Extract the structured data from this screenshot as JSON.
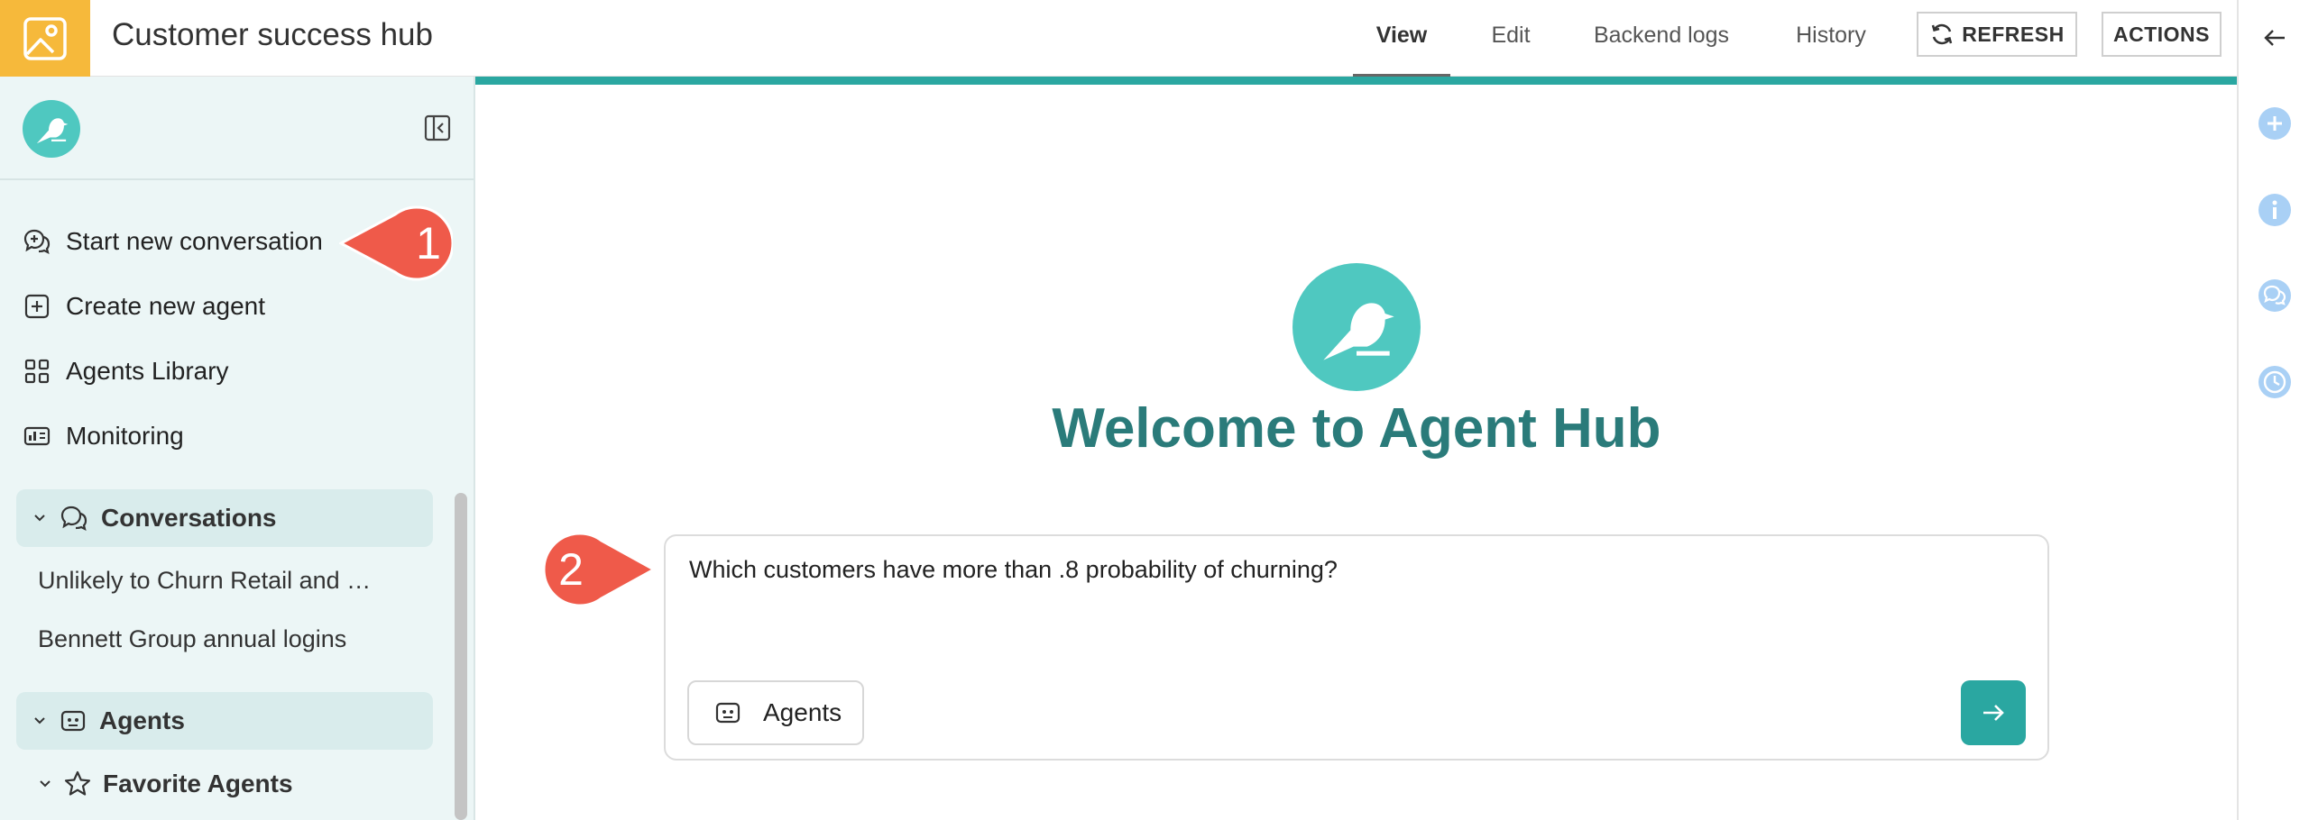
{
  "header": {
    "app_icon": "image-icon",
    "title": "Customer success hub",
    "tabs": [
      {
        "label": "View",
        "active": true
      },
      {
        "label": "Edit",
        "active": false
      },
      {
        "label": "Backend logs",
        "active": false
      },
      {
        "label": "History",
        "active": false
      }
    ],
    "refresh_label": "REFRESH",
    "actions_label": "ACTIONS"
  },
  "sidebar": {
    "logo_icon": "bird-icon",
    "collapse_icon": "collapse-panel-icon",
    "items": [
      {
        "label": "Start new conversation",
        "icon": "chat-plus-icon"
      },
      {
        "label": "Create new agent",
        "icon": "square-plus-icon"
      },
      {
        "label": "Agents Library",
        "icon": "grid-icon"
      },
      {
        "label": "Monitoring",
        "icon": "monitoring-icon"
      }
    ],
    "conversations": {
      "label": "Conversations",
      "items": [
        "Unlikely to Churn Retail and …",
        "Bennett Group annual logins"
      ]
    },
    "agents": {
      "label": "Agents",
      "favorite_label": "Favorite Agents"
    }
  },
  "callouts": [
    "1",
    "2"
  ],
  "main": {
    "welcome_title": "Welcome to Agent Hub",
    "prompt_text": "Which customers have more than .8 probability of churning?",
    "agents_button_label": "Agents",
    "send_icon": "arrow-right-icon"
  },
  "rail": {
    "back_icon": "arrow-left-icon",
    "buttons": [
      "plus-circle-icon",
      "info-icon",
      "chat-icon",
      "clock-icon"
    ]
  },
  "colors": {
    "brand_yellow": "#f6b93b",
    "teal": "#2aa7a1",
    "logo_teal": "#4fc8c0",
    "title_teal": "#2a7b7a",
    "sidebar_bg": "#ecf6f6",
    "callout_red": "#ef5a4a",
    "rail_blue": "#a9d0f5"
  }
}
